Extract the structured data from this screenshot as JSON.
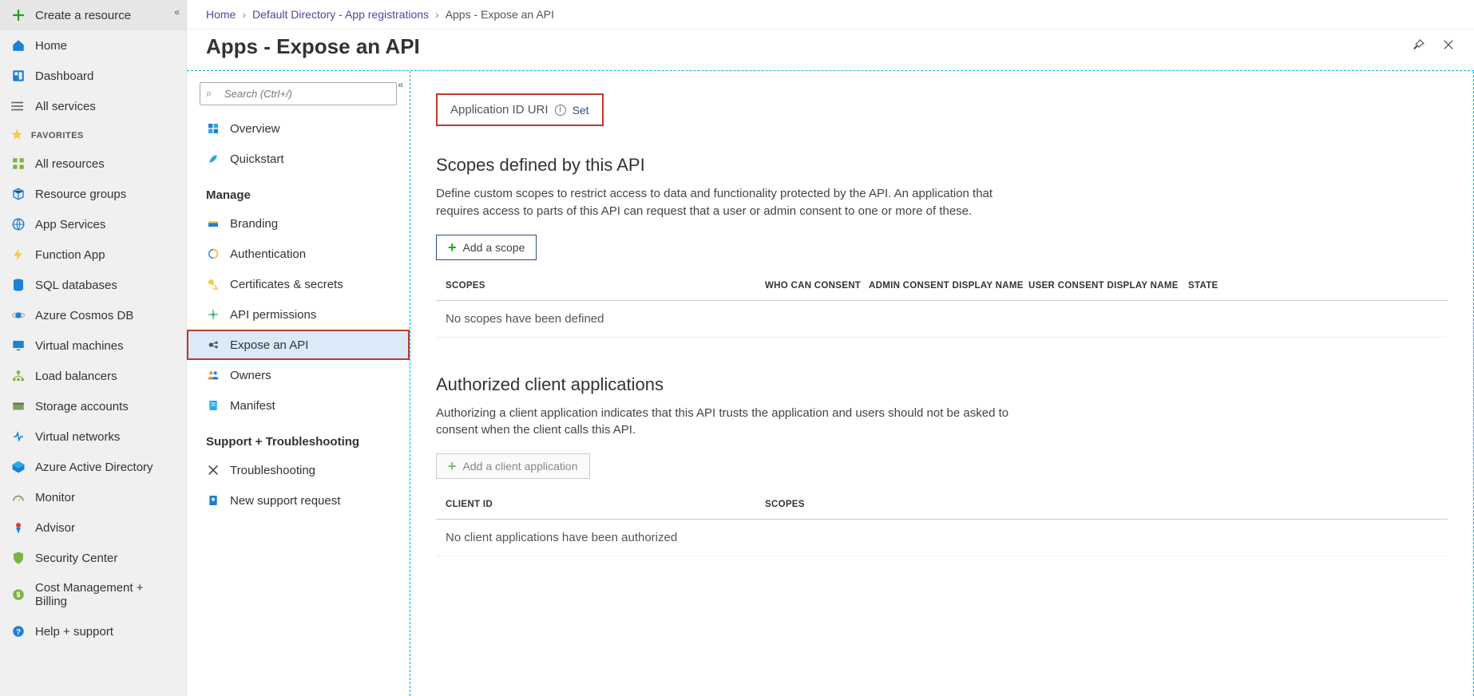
{
  "breadcrumbs": {
    "items": [
      "Home",
      "Default Directory - App registrations",
      "Apps - Expose an API"
    ]
  },
  "pageTitle": "Apps - Expose an API",
  "globalNav": {
    "createResource": "Create a resource",
    "home": "Home",
    "dashboard": "Dashboard",
    "allServices": "All services",
    "favoritesHeader": "FAVORITES",
    "allResources": "All resources",
    "resourceGroups": "Resource groups",
    "appServices": "App Services",
    "functionApp": "Function App",
    "sqlDatabases": "SQL databases",
    "cosmosDb": "Azure Cosmos DB",
    "virtualMachines": "Virtual machines",
    "loadBalancers": "Load balancers",
    "storageAccounts": "Storage accounts",
    "virtualNetworks": "Virtual networks",
    "aad": "Azure Active Directory",
    "monitor": "Monitor",
    "advisor": "Advisor",
    "securityCenter": "Security Center",
    "costMgmt": "Cost Management + Billing",
    "helpSupport": "Help + support"
  },
  "subNav": {
    "searchPlaceholder": "Search (Ctrl+/)",
    "overview": "Overview",
    "quickstart": "Quickstart",
    "manageHeader": "Manage",
    "branding": "Branding",
    "authentication": "Authentication",
    "certsSecrets": "Certificates & secrets",
    "apiPermissions": "API permissions",
    "exposeApi": "Expose an API",
    "owners": "Owners",
    "manifest": "Manifest",
    "supportHeader": "Support + Troubleshooting",
    "troubleshooting": "Troubleshooting",
    "newSupport": "New support request"
  },
  "detail": {
    "appIdUriLabel": "Application ID URI",
    "setLabel": "Set",
    "scopes": {
      "heading": "Scopes defined by this API",
      "description": "Define custom scopes to restrict access to data and functionality protected by the API. An application that requires access to parts of this API can request that a user or admin consent to one or more of these.",
      "addLabel": "Add a scope",
      "headers": {
        "scopes": "SCOPES",
        "whoConsent": "WHO CAN CONSENT",
        "adminDisplay": "ADMIN CONSENT DISPLAY NAME",
        "userDisplay": "USER CONSENT DISPLAY NAME",
        "state": "STATE"
      },
      "empty": "No scopes have been defined"
    },
    "clients": {
      "heading": "Authorized client applications",
      "description": "Authorizing a client application indicates that this API trusts the application and users should not be asked to consent when the client calls this API.",
      "addLabel": "Add a client application",
      "headers": {
        "clientId": "CLIENT ID",
        "scopes": "SCOPES"
      },
      "empty": "No client applications have been authorized"
    }
  }
}
